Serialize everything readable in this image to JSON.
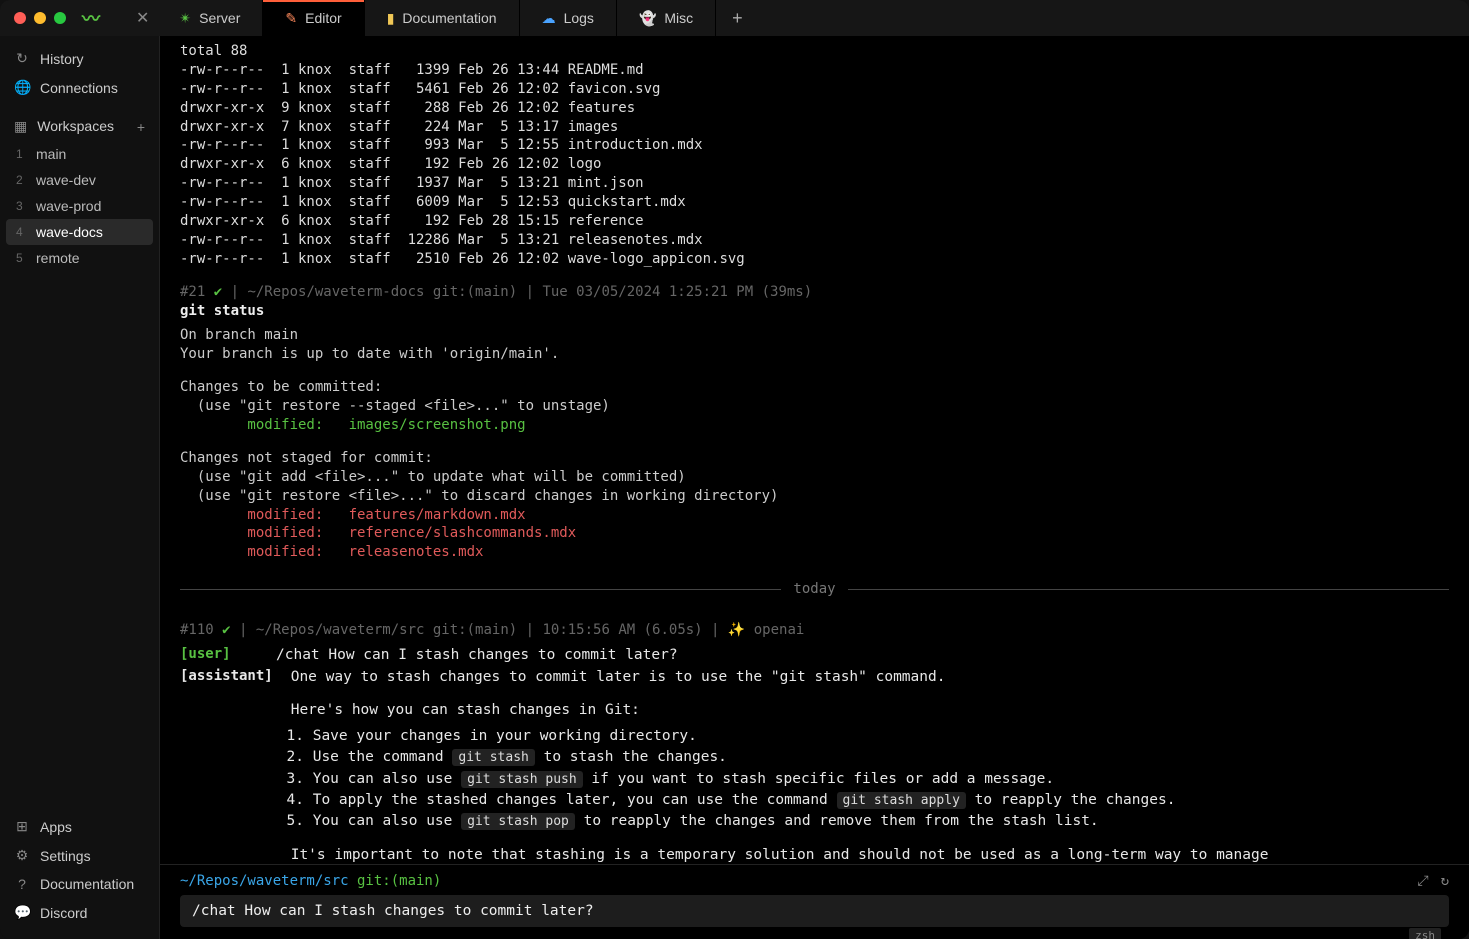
{
  "titlebar": {
    "tabs": [
      {
        "icon": "✴",
        "icon_color": "#58c142",
        "label": "Server",
        "active": false
      },
      {
        "icon": "✎",
        "icon_color": "#ff8a5c",
        "label": "Editor",
        "active": true
      },
      {
        "icon": "▮",
        "icon_color": "#f0c756",
        "label": "Documentation",
        "active": false
      },
      {
        "icon": "☁",
        "icon_color": "#4aa3ff",
        "label": "Logs",
        "active": false
      },
      {
        "icon": "👻",
        "icon_color": "#b98cff",
        "label": "Misc",
        "active": false
      }
    ]
  },
  "sidebar": {
    "history": "History",
    "connections": "Connections",
    "workspaces_label": "Workspaces",
    "workspaces": [
      {
        "n": "1",
        "name": "main"
      },
      {
        "n": "2",
        "name": "wave-dev"
      },
      {
        "n": "3",
        "name": "wave-prod"
      },
      {
        "n": "4",
        "name": "wave-docs",
        "active": true
      },
      {
        "n": "5",
        "name": "remote"
      }
    ],
    "bottom": [
      {
        "icon": "⊞",
        "label": "Apps"
      },
      {
        "icon": "⚙",
        "label": "Settings"
      },
      {
        "icon": "?",
        "label": "Documentation"
      },
      {
        "icon": "💬",
        "label": "Discord"
      }
    ]
  },
  "ls": {
    "total": "total 88",
    "rows": [
      "-rw-r--r--  1 knox  staff   1399 Feb 26 13:44 README.md",
      "-rw-r--r--  1 knox  staff   5461 Feb 26 12:02 favicon.svg",
      "drwxr-xr-x  9 knox  staff    288 Feb 26 12:02 features",
      "drwxr-xr-x  7 knox  staff    224 Mar  5 13:17 images",
      "-rw-r--r--  1 knox  staff    993 Mar  5 12:55 introduction.mdx",
      "drwxr-xr-x  6 knox  staff    192 Feb 26 12:02 logo",
      "-rw-r--r--  1 knox  staff   1937 Mar  5 13:21 mint.json",
      "-rw-r--r--  1 knox  staff   6009 Mar  5 12:53 quickstart.mdx",
      "drwxr-xr-x  6 knox  staff    192 Feb 28 15:15 reference",
      "-rw-r--r--  1 knox  staff  12286 Mar  5 13:21 releasenotes.mdx",
      "-rw-r--r--  1 knox  staff   2510 Feb 26 12:02 wave-logo_appicon.svg"
    ]
  },
  "cmd21": {
    "meta_prefix": "#21 ",
    "meta_rest": " |  ~/Repos/waveterm-docs git:(main) |  Tue 03/05/2024 1:25:21 PM (39ms)",
    "command": "git status",
    "branch_line": "On branch main",
    "uptodate": "Your branch is up to date with 'origin/main'.",
    "to_commit_hdr": "Changes to be committed:",
    "to_commit_hint": "  (use \"git restore --staged <file>...\" to unstage)",
    "staged": "        modified:   images/screenshot.png",
    "not_staged_hdr": "Changes not staged for commit:",
    "not_staged_hint1": "  (use \"git add <file>...\" to update what will be committed)",
    "not_staged_hint2": "  (use \"git restore <file>...\" to discard changes in working directory)",
    "unstaged": [
      "        modified:   features/markdown.mdx",
      "        modified:   reference/slashcommands.mdx",
      "        modified:   releasenotes.mdx"
    ]
  },
  "divider_label": "today",
  "cmd110": {
    "meta_prefix": "#110 ",
    "meta_rest": " |  ~/Repos/waveterm/src git:(main) |  10:15:56 AM (6.05s) |  ✨ openai",
    "user_label": "[user]",
    "assistant_label": "[assistant]",
    "user_text": "/chat How can I stash changes to commit later?",
    "a1": "One way to stash changes to commit later is to use the \"git stash\" command.",
    "a2": "Here's how you can stash changes in Git:",
    "steps": [
      {
        "pre": "Save your changes in your working directory."
      },
      {
        "pre": "Use the command ",
        "code": "git stash",
        "post": " to stash the changes."
      },
      {
        "pre": "You can also use ",
        "code": "git stash push",
        "post": " if you want to stash specific files or add a message."
      },
      {
        "pre": "To apply the stashed changes later, you can use the command ",
        "code": "git stash apply",
        "post": " to reapply the changes."
      },
      {
        "pre": "You can also use ",
        "code": "git stash pop",
        "post": " to reapply the changes and remove them from the stash list."
      }
    ],
    "a3": "It's important to note that stashing is a temporary solution and should not be used as a long-term way to manage changes. It is best to commit changes when they are ready to be saved permanently."
  },
  "prompt": {
    "path": "~/Repos/waveterm/src",
    "git": " git:(main)",
    "input": "/chat How can I stash changes to commit later?",
    "shell": "zsh"
  }
}
